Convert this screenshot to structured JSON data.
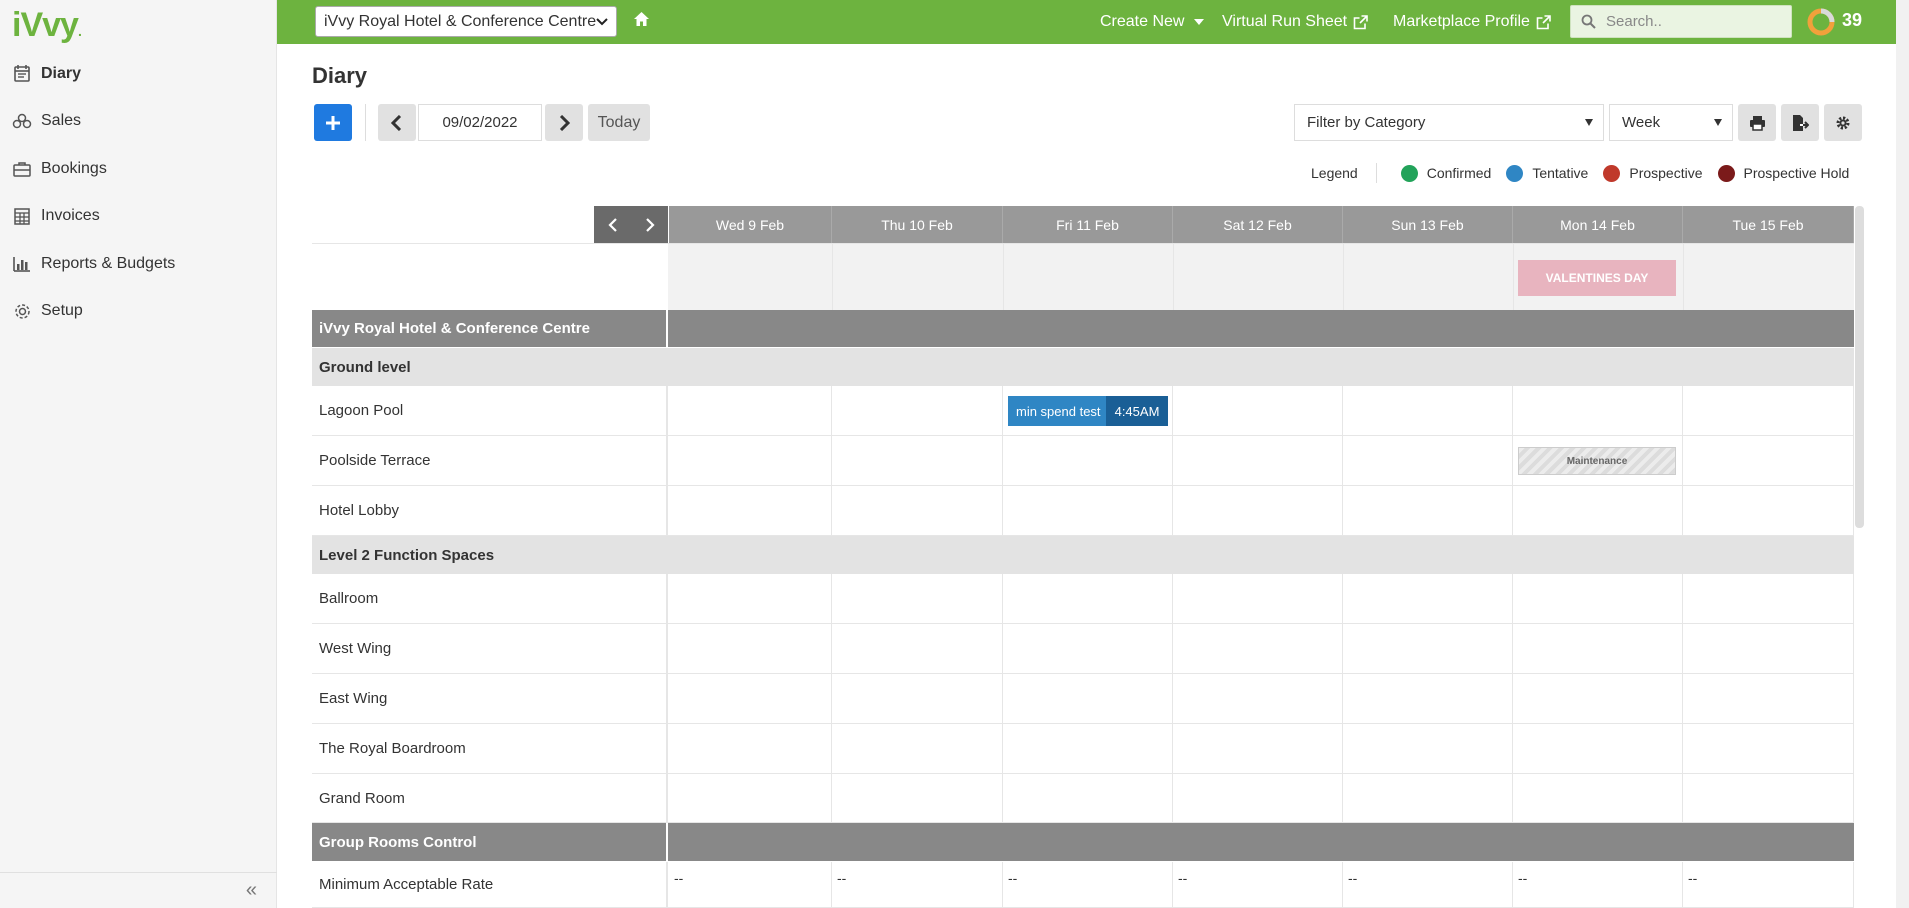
{
  "logo": {
    "text": "iVvy"
  },
  "sidebar": {
    "items": [
      {
        "label": "Diary",
        "icon": "diary-icon",
        "active": true
      },
      {
        "label": "Sales",
        "icon": "sales-icon"
      },
      {
        "label": "Bookings",
        "icon": "bookings-icon"
      },
      {
        "label": "Invoices",
        "icon": "invoices-icon"
      },
      {
        "label": "Reports & Budgets",
        "icon": "reports-icon"
      },
      {
        "label": "Setup",
        "icon": "setup-icon"
      }
    ],
    "collapse_label": "«"
  },
  "topbar": {
    "venue": "iVvy Royal Hotel & Conference Centre",
    "create_new": "Create New",
    "virtual_run_sheet": "Virtual Run Sheet",
    "marketplace_profile": "Marketplace Profile",
    "search_placeholder": "Search..",
    "count": "39"
  },
  "page": {
    "title": "Diary"
  },
  "toolbar": {
    "date": "09/02/2022",
    "today": "Today",
    "filter": "Filter by Category",
    "view": "Week"
  },
  "legend": {
    "title": "Legend",
    "items": [
      {
        "label": "Confirmed",
        "color": "#22a35a"
      },
      {
        "label": "Tentative",
        "color": "#2f86c4"
      },
      {
        "label": "Prospective",
        "color": "#c0392b"
      },
      {
        "label": "Prospective Hold",
        "color": "#7b1a1a"
      }
    ]
  },
  "grid": {
    "days": [
      "Wed 9 Feb",
      "Thu 10 Feb",
      "Fri 11 Feb",
      "Sat 12 Feb",
      "Sun 13 Feb",
      "Mon 14 Feb",
      "Tue 15 Feb"
    ],
    "special_day": "VALENTINES DAY",
    "venue_row": "iVvy Royal Hotel & Conference Centre",
    "groups": [
      {
        "label": "Ground level",
        "rooms": [
          "Lagoon Pool",
          "Poolside Terrace",
          "Hotel Lobby"
        ]
      },
      {
        "label": "Level 2 Function Spaces",
        "rooms": [
          "Ballroom",
          "West Wing",
          "East Wing",
          "The Royal Boardroom",
          "Grand Room"
        ]
      }
    ],
    "group_rooms": {
      "label": "Group Rooms Control",
      "rate_label": "Minimum Acceptable Rate",
      "rate_value": "--"
    },
    "booking": {
      "name": "min spend test",
      "time": "4:45AM"
    },
    "maintenance": "Maintenance"
  }
}
